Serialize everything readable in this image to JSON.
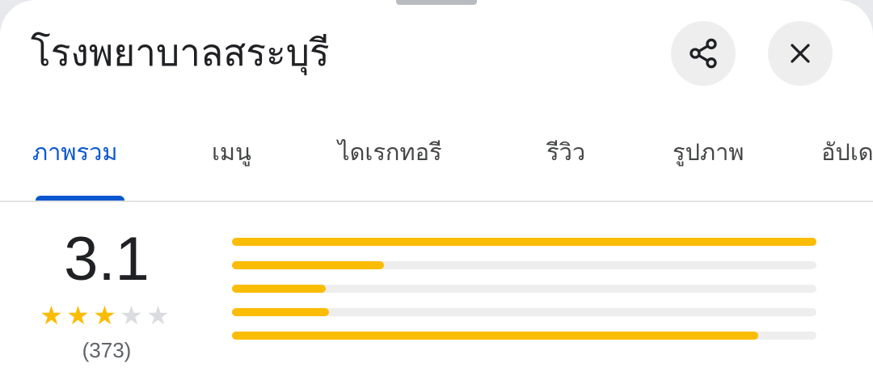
{
  "header": {
    "title": "โรงพยาบาลสระบุรี",
    "share_icon": "share-icon",
    "close_icon": "close-icon"
  },
  "tabs": [
    {
      "label": "ภาพรวม",
      "active": true
    },
    {
      "label": "เมนู",
      "active": false
    },
    {
      "label": "ไดเรกทอรี",
      "active": false
    },
    {
      "label": "รีวิว",
      "active": false
    },
    {
      "label": "รูปภาพ",
      "active": false
    },
    {
      "label": "อัปเด",
      "active": false
    }
  ],
  "rating": {
    "score": "3.1",
    "stars_filled": 3,
    "stars_total": 5,
    "count": "(373)",
    "distribution_fraction": [
      1.0,
      0.26,
      0.16,
      0.166,
      0.9
    ]
  },
  "colors": {
    "accent": "#0b57d0",
    "star": "#fbbc04",
    "star_empty": "#dadce0"
  }
}
